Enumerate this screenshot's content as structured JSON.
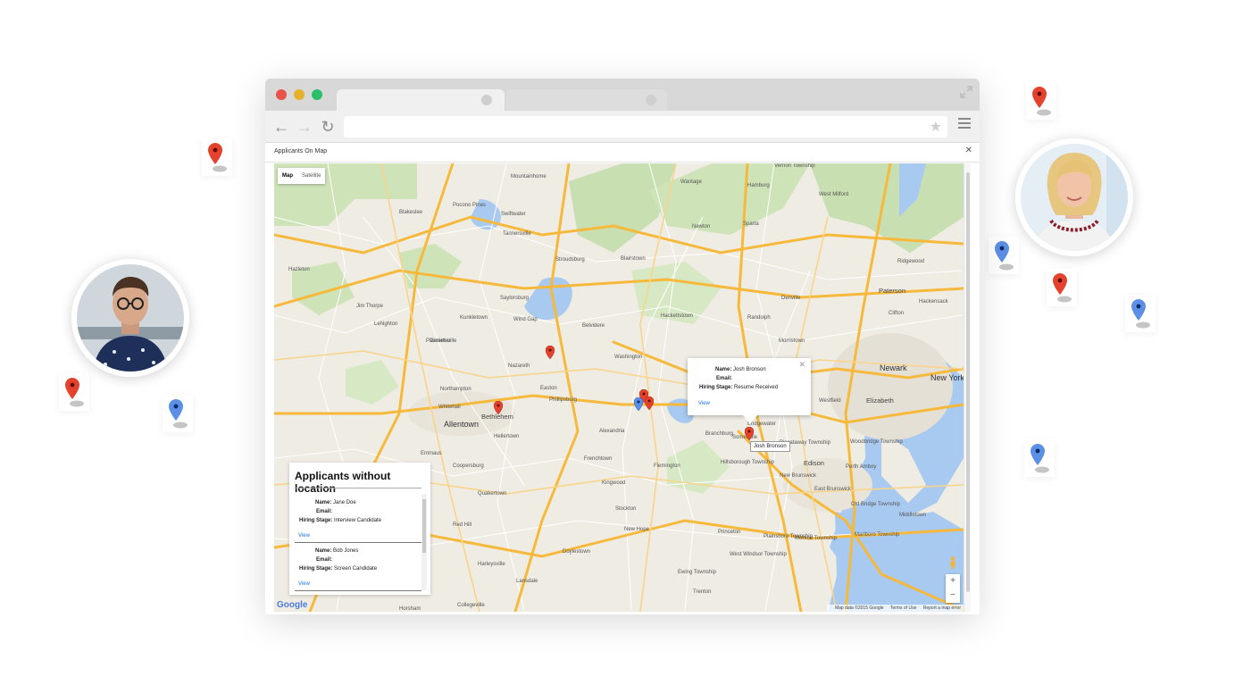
{
  "window": {
    "title": "Applicants On Map"
  },
  "map": {
    "type_control": {
      "map_label": "Map",
      "satellite_label": "Satellite"
    },
    "places_large": [
      "Allentown",
      "Bethlehem",
      "Newark",
      "New York",
      "Paterson",
      "Edison",
      "Elizabeth"
    ],
    "places": {
      "p1": "Stroudsburg",
      "p2": "Mountainhome",
      "p3": "Blakeslee",
      "p4": "Pocono Pines",
      "p5": "Swiftwater",
      "p6": "Tannersville",
      "p7": "Hazleton",
      "p8": "Jim Thorpe",
      "p9": "Lehighton",
      "p10": "Palmerton",
      "p11": "Saylorsburg",
      "p12": "Kunkletown",
      "p13": "Wind Gap",
      "p14": "Nazareth",
      "p15": "Easton",
      "p16": "Northampton",
      "p17": "Whitehall",
      "p18": "Hellertown",
      "p19": "Coopersburg",
      "p20": "Emmaus",
      "p21": "Quakertown",
      "p22": "Red Hill",
      "p23": "Harleysville",
      "p24": "Lansdale",
      "p25": "Doylestown",
      "p26": "New Hope",
      "p27": "Stockton",
      "p28": "Flemington",
      "p29": "Alexandria",
      "p30": "Frenchtown",
      "p31": "Kingwood",
      "p32": "Phillipsburg",
      "p33": "Washington",
      "p34": "Hackettstown",
      "p35": "Belvidere",
      "p36": "Blairstown",
      "p37": "Hamburg",
      "p38": "Newton",
      "p39": "Sparta",
      "p40": "West Milford",
      "p41": "Morristown",
      "p42": "Randolph",
      "p43": "Denville",
      "p44": "Clifton",
      "p45": "Hackensack",
      "p46": "Ridgewood",
      "p47": "Bridgewater",
      "p48": "Somerville",
      "p49": "Branchburg",
      "p50": "Hillsborough Township",
      "p51": "Piscataway Township",
      "p52": "New Brunswick",
      "p53": "Woodbridge Township",
      "p54": "Perth Amboy",
      "p55": "East Brunswick",
      "p56": "Old Bridge Township",
      "p57": "Middletown",
      "p58": "Princeton",
      "p59": "Monroe Township",
      "p60": "Plainsboro Township",
      "p61": "West Windsor Township",
      "p62": "Trenton",
      "p63": "Ewing Township",
      "p64": "Marlboro Township",
      "p65": "Westfield",
      "p66": "Collegeville",
      "p67": "Horsham",
      "p68": "Vernon Township",
      "p69": "Wantage",
      "p70": "Danielsville"
    },
    "info_window": {
      "name_label": "Name:",
      "name": "Josh Bronson",
      "email_label": "Email:",
      "email": "",
      "stage_label": "Hiring Stage:",
      "stage": "Resume Received",
      "link": "View"
    },
    "hover_tooltip": "Josh Bronson",
    "footer": {
      "data": "Map data ©2015 Google",
      "terms": "Terms of Use",
      "report": "Report a map error"
    },
    "logo": "Google",
    "zoom_in": "+",
    "zoom_out": "−"
  },
  "no_location_panel": {
    "title": "Applicants without location",
    "applicants": [
      {
        "name_label": "Name:",
        "name": "Jane Doe",
        "email_label": "Email:",
        "email": "",
        "stage_label": "Hiring Stage:",
        "stage": "Interview Candidate",
        "link": "View"
      },
      {
        "name_label": "Name:",
        "name": "Bob Jones",
        "email_label": "Email:",
        "email": "",
        "stage_label": "Hiring Stage:",
        "stage": "Screen Candidate",
        "link": "View"
      }
    ]
  },
  "colors": {
    "pin_red": "#e5422e",
    "pin_blue": "#5c8fe6",
    "road": "#f6b93b",
    "water": "#a8c9f0",
    "park": "#c8dfb2"
  }
}
